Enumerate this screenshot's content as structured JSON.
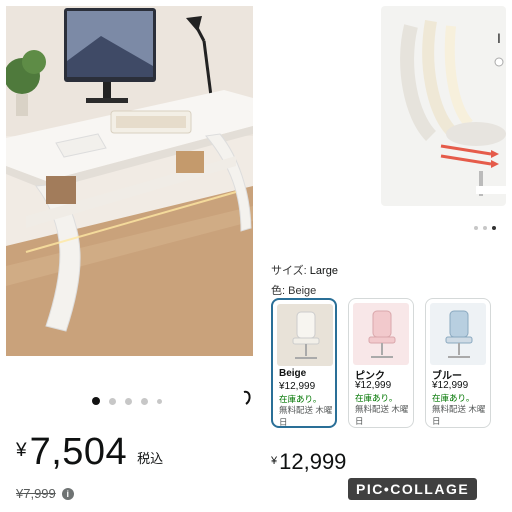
{
  "left_panel": {
    "carousel": {
      "count": 5,
      "active_index": 0
    },
    "price": {
      "currency": "¥",
      "amount": "7,504",
      "tax_note": "税込"
    },
    "reference_price": {
      "label": "¥7,999",
      "info_icon": "info-icon"
    }
  },
  "right_top": {
    "hero_char": "I",
    "carousel": {
      "count": 3,
      "active_index": 2
    }
  },
  "variants": {
    "size_label": "サイズ:",
    "size_value": "Large",
    "color_label": "色:",
    "color_value": "Beige",
    "options": [
      {
        "name": "Beige",
        "price": "¥12,999",
        "stock": "在庫あり。",
        "shipping": "無料配送 木曜日",
        "selected": true,
        "color": "#e8e2d8"
      },
      {
        "name": "ピンク",
        "price": "¥12,999",
        "stock": "在庫あり。",
        "shipping": "無料配送 木曜日",
        "selected": false,
        "color": "#f2c9cc"
      },
      {
        "name": "ブルー",
        "price": "¥12,999",
        "stock": "在庫あり。",
        "shipping": "無料配送 木曜日",
        "selected": false,
        "color": "#b8cfe0"
      }
    ],
    "price": {
      "currency": "¥",
      "amount": "12,999"
    }
  },
  "watermark": "PIC•COLLAGE"
}
